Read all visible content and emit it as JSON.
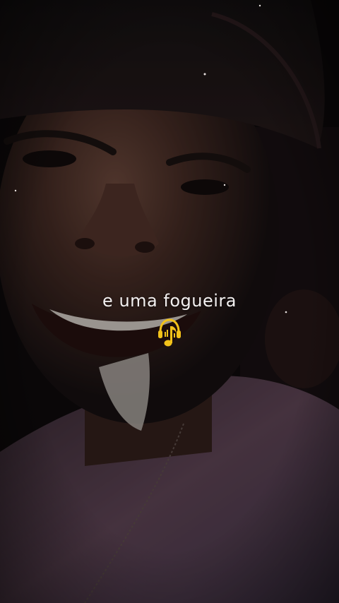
{
  "overlay": {
    "caption": "e uma fogueira"
  },
  "logo": {
    "icon": "headphones-music-logo-icon",
    "color": "#f2c21a"
  },
  "colors": {
    "background": "#0d0b0c",
    "caption_text": "#f3f0f0",
    "shirt": "#6a4d60"
  }
}
